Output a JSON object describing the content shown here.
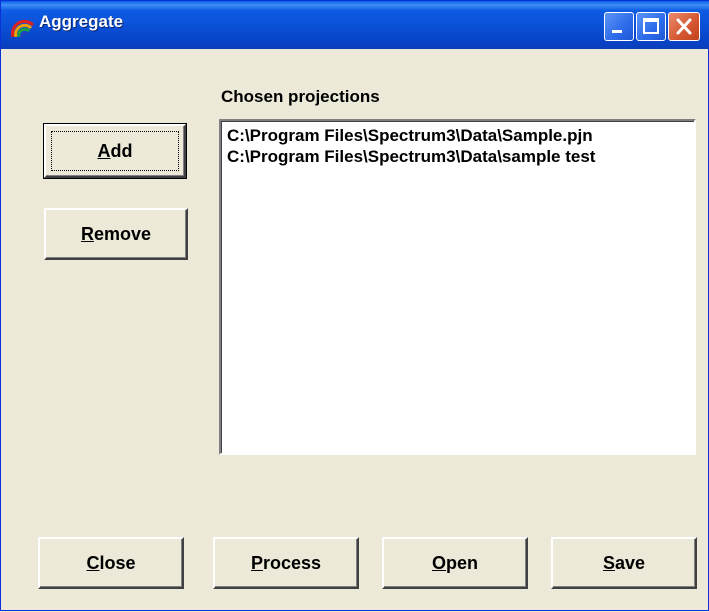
{
  "window": {
    "title": "Aggregate",
    "app_icon": "rainbow-icon",
    "controls": [
      "minimize-icon",
      "maximize-icon",
      "close-icon"
    ],
    "title_bar_color": "#0A4FD6",
    "background_color": "#ECE9D8"
  },
  "projections": {
    "label": "Chosen projections",
    "items": [
      "C:\\Program Files\\Spectrum3\\Data\\Sample.pjn",
      "C:\\Program Files\\Spectrum3\\Data\\sample test"
    ]
  },
  "buttons": {
    "add": {
      "mnemonic": "A",
      "rest": "dd"
    },
    "remove": {
      "mnemonic": "R",
      "rest": "emove"
    },
    "close": {
      "mnemonic": "C",
      "rest": "lose"
    },
    "process": {
      "mnemonic": "P",
      "rest": "rocess"
    },
    "open": {
      "mnemonic": "O",
      "rest": "pen"
    },
    "save": {
      "mnemonic": "S",
      "rest": "ave"
    }
  }
}
